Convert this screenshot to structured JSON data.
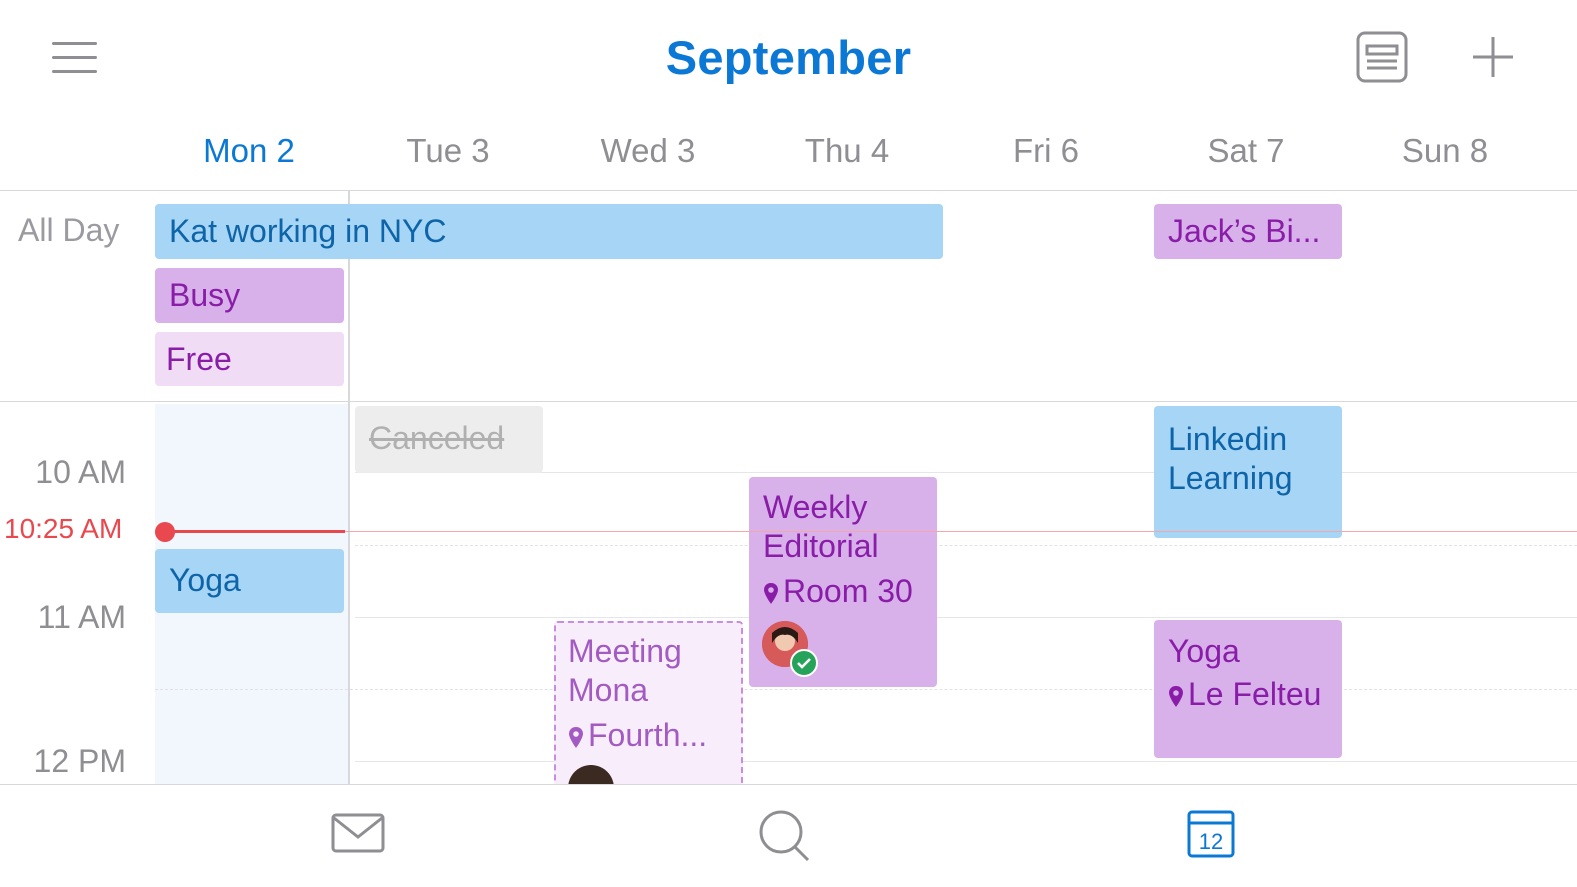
{
  "header": {
    "title": "September",
    "menu_icon": "hamburger-menu-icon",
    "agenda_icon": "agenda-view-icon",
    "add_icon": "plus-icon"
  },
  "days": [
    {
      "label": "Mon 2",
      "today": true
    },
    {
      "label": "Tue 3",
      "today": false
    },
    {
      "label": "Wed 3",
      "today": false
    },
    {
      "label": "Thu 4",
      "today": false
    },
    {
      "label": "Fri 6",
      "today": false
    },
    {
      "label": "Sat 7",
      "today": false
    },
    {
      "label": "Sun 8",
      "today": false
    }
  ],
  "all_day": {
    "label": "All Day",
    "events": [
      {
        "title": "Kat working in NYC",
        "color": "blue"
      },
      {
        "title": "Busy",
        "color": "purple"
      },
      {
        "title": "Free",
        "color": "lightpurple"
      },
      {
        "title": "Jack’s Bi...",
        "color": "purple"
      }
    ]
  },
  "times": {
    "t10": "10 AM",
    "now": "10:25 AM",
    "t11": "11 AM",
    "t12": "12 PM"
  },
  "events": {
    "canceled": {
      "title": "Canceled"
    },
    "yoga_mon": {
      "title": "Yoga"
    },
    "weekly": {
      "title1": "Weekly",
      "title2": "Editorial",
      "location": "Room 30"
    },
    "meeting": {
      "title1": "Meeting",
      "title2": "Mona",
      "location": "Fourth..."
    },
    "linkedin": {
      "title1": "Linkedin",
      "title2": "Learning"
    },
    "yoga_sat": {
      "title": "Yoga",
      "location": "Le Felteu"
    }
  },
  "colors": {
    "accent": "#0a78d4",
    "now": "#e8484e",
    "blue_event": "#a6d5f5",
    "purple_event": "#d8b1ea"
  },
  "tabbar": {
    "mail_icon": "mail-icon",
    "search_icon": "search-icon",
    "calendar_icon": "calendar-icon",
    "calendar_day": "12"
  }
}
